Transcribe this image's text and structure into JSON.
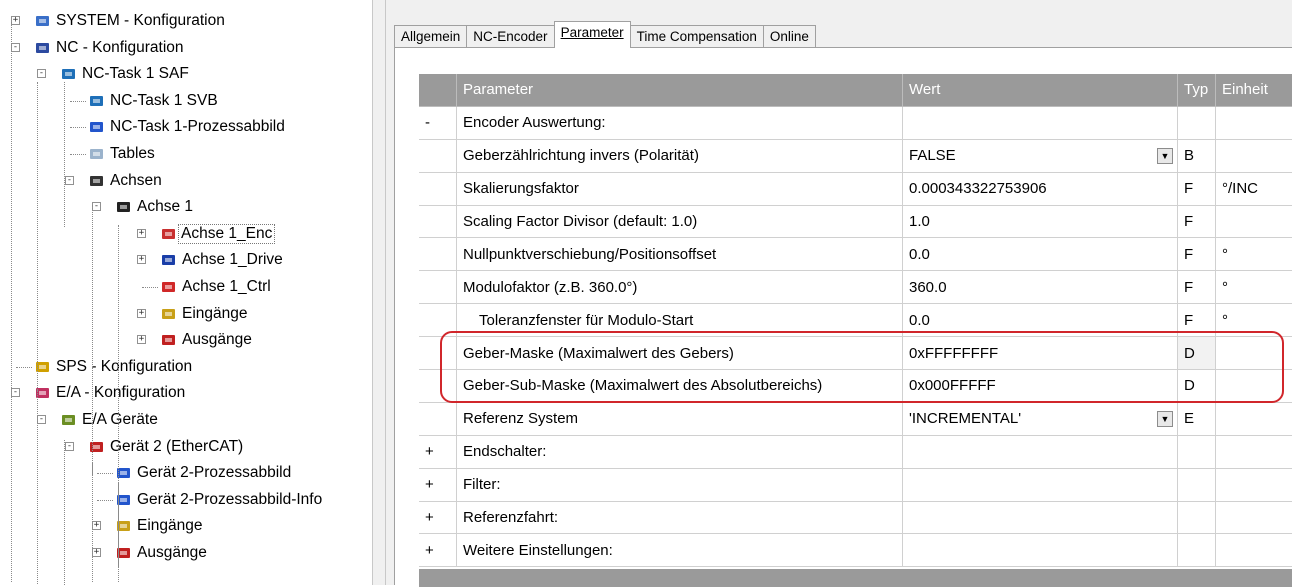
{
  "tree": {
    "items": [
      {
        "label": "SYSTEM - Konfiguration",
        "icon": "system-config-icon",
        "exp": "+"
      },
      {
        "label": "NC - Konfiguration",
        "icon": "nc-config-icon",
        "exp": "-"
      },
      {
        "label": "NC-Task 1 SAF",
        "icon": "task-icon",
        "exp": "-"
      },
      {
        "label": "NC-Task 1 SVB",
        "icon": "task-icon"
      },
      {
        "label": "NC-Task 1-Prozessabbild",
        "icon": "process-image-icon"
      },
      {
        "label": "Tables",
        "icon": "table-icon"
      },
      {
        "label": "Achsen",
        "icon": "axes-icon",
        "exp": "-"
      },
      {
        "label": "Achse 1",
        "icon": "axis-icon",
        "exp": "-"
      },
      {
        "label": "Achse 1_Enc",
        "icon": "encoder-icon",
        "exp": "+",
        "selected": true
      },
      {
        "label": "Achse 1_Drive",
        "icon": "drive-icon",
        "exp": "+"
      },
      {
        "label": "Achse 1_Ctrl",
        "icon": "controller-icon"
      },
      {
        "label": "Eingänge",
        "icon": "inputs-icon",
        "exp": "+"
      },
      {
        "label": "Ausgänge",
        "icon": "outputs-icon",
        "exp": "+"
      },
      {
        "label": "SPS - Konfiguration",
        "icon": "plc-config-icon"
      },
      {
        "label": "E/A - Konfiguration",
        "icon": "io-config-icon",
        "exp": "-"
      },
      {
        "label": "E/A Geräte",
        "icon": "io-devices-icon",
        "exp": "-"
      },
      {
        "label": "Gerät 2 (EtherCAT)",
        "icon": "ethercat-device-icon",
        "exp": "-"
      },
      {
        "label": "Gerät 2-Prozessabbild",
        "icon": "process-image-icon"
      },
      {
        "label": "Gerät 2-Prozessabbild-Info",
        "icon": "process-image-icon"
      },
      {
        "label": "Eingänge",
        "icon": "inputs-icon",
        "exp": "+"
      },
      {
        "label": "Ausgänge",
        "icon": "outputs-icon",
        "exp": "+"
      }
    ]
  },
  "tabs": [
    {
      "label": "Allgemein",
      "active": false
    },
    {
      "label": "NC-Encoder",
      "active": false
    },
    {
      "label": "Parameter",
      "active": true
    },
    {
      "label": "Time Compensation",
      "active": false
    },
    {
      "label": "Online",
      "active": false
    }
  ],
  "grid": {
    "headers": {
      "param": "Parameter",
      "value": "Wert",
      "type": "Typ",
      "unit": "Einheit"
    },
    "rows": [
      {
        "sign": "-",
        "param": "Encoder Auswertung:",
        "value": "",
        "type": "",
        "unit": "",
        "group": true
      },
      {
        "sign": "",
        "param": "Geberzählrichtung invers (Polarität)",
        "value": "FALSE",
        "type": "B",
        "unit": "",
        "dropdown": true
      },
      {
        "sign": "",
        "param": "Skalierungsfaktor",
        "value": "0.000343322753906",
        "type": "F",
        "unit": "°/INC"
      },
      {
        "sign": "",
        "param": "Scaling Factor Divisor (default: 1.0)",
        "value": "1.0",
        "type": "F",
        "unit": ""
      },
      {
        "sign": "",
        "param": "Nullpunktverschiebung/Positionsoffset",
        "value": "0.0",
        "type": "F",
        "unit": "°"
      },
      {
        "sign": "",
        "param": "Modulofaktor (z.B. 360.0°)",
        "value": "360.0",
        "type": "F",
        "unit": "°"
      },
      {
        "sign": "",
        "param": "Toleranzfenster für Modulo-Start",
        "value": "0.0",
        "type": "F",
        "unit": "°",
        "indent": true
      },
      {
        "sign": "",
        "param": "Geber-Maske (Maximalwert des Gebers)",
        "value": "0xFFFFFFFF",
        "type": "D",
        "unit": "",
        "grayType": true
      },
      {
        "sign": "",
        "param": "Geber-Sub-Maske (Maximalwert des Absolutbereichs)",
        "value": "0x000FFFFF",
        "type": "D",
        "unit": ""
      },
      {
        "sign": "",
        "param": "Referenz System",
        "value": "'INCREMENTAL'",
        "type": "E",
        "unit": "",
        "dropdown": true
      },
      {
        "sign": "+",
        "param": "Endschalter:",
        "value": "",
        "type": "",
        "unit": "",
        "group": true
      },
      {
        "sign": "+",
        "param": "Filter:",
        "value": "",
        "type": "",
        "unit": "",
        "group": true
      },
      {
        "sign": "+",
        "param": "Referenzfahrt:",
        "value": "",
        "type": "",
        "unit": "",
        "group": true
      },
      {
        "sign": "+",
        "param": "Weitere Einstellungen:",
        "value": "",
        "type": "",
        "unit": "",
        "group": true
      }
    ]
  },
  "colors": {
    "header_bg": "#9a9a9a",
    "highlight": "#d1262b",
    "panel_bg": "#f0f0f0"
  }
}
